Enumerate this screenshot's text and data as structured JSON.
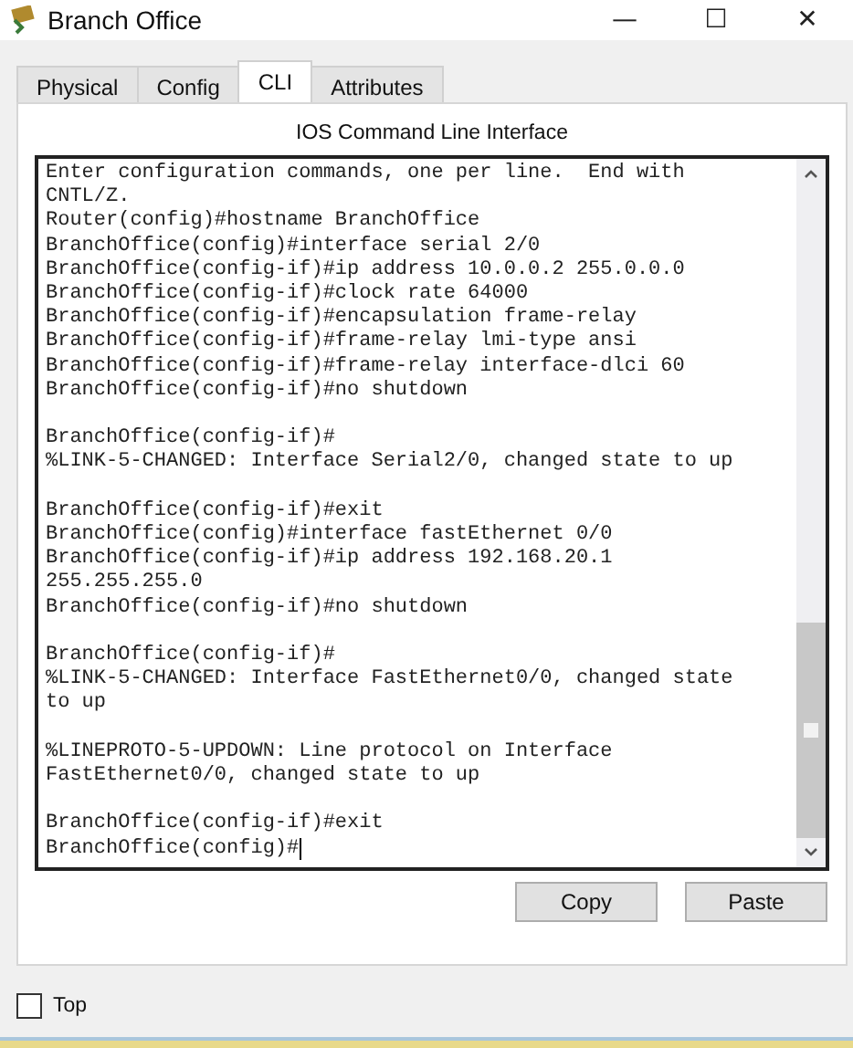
{
  "window": {
    "title": "Branch Office",
    "controls": [
      "—",
      "☐",
      "✕"
    ]
  },
  "tabs": [
    {
      "label": "Physical",
      "selected": false
    },
    {
      "label": "Config",
      "selected": false
    },
    {
      "label": "CLI",
      "selected": true
    },
    {
      "label": "Attributes",
      "selected": false
    }
  ],
  "cli": {
    "heading": "IOS Command Line Interface",
    "blocks": [
      [
        "Enter configuration commands, one per line.  End with",
        "CNTL/Z.",
        "Router(config)#hostname BranchOffice",
        "BranchOffice(config)#interface serial 2/0",
        "BranchOffice(config-if)#ip address 10.0.0.2 255.0.0.0",
        "BranchOffice(config-if)#clock rate 64000",
        "BranchOffice(config-if)#encapsulation frame-relay",
        "BranchOffice(config-if)#frame-relay lmi-type ansi",
        "BranchOffice(config-if)#frame-relay interface-dlci 60",
        "BranchOffice(config-if)#no shutdown"
      ],
      [
        "BranchOffice(config-if)#",
        "%LINK-5-CHANGED: Interface Serial2/0, changed state to up"
      ],
      [
        "BranchOffice(config-if)#exit",
        "BranchOffice(config)#interface fastEthernet 0/0",
        "BranchOffice(config-if)#ip address 192.168.20.1",
        "255.255.255.0",
        "BranchOffice(config-if)#no shutdown"
      ],
      [
        "BranchOffice(config-if)#",
        "%LINK-5-CHANGED: Interface FastEthernet0/0, changed state",
        "to up"
      ],
      [
        "%LINEPROTO-5-UPDOWN: Line protocol on Interface",
        "FastEthernet0/0, changed state to up"
      ],
      [
        "BranchOffice(config-if)#exit",
        "BranchOffice(config)#"
      ]
    ],
    "buttons": [
      "Copy",
      "Paste"
    ]
  },
  "top_checkbox": {
    "label": "Top",
    "checked": false
  }
}
